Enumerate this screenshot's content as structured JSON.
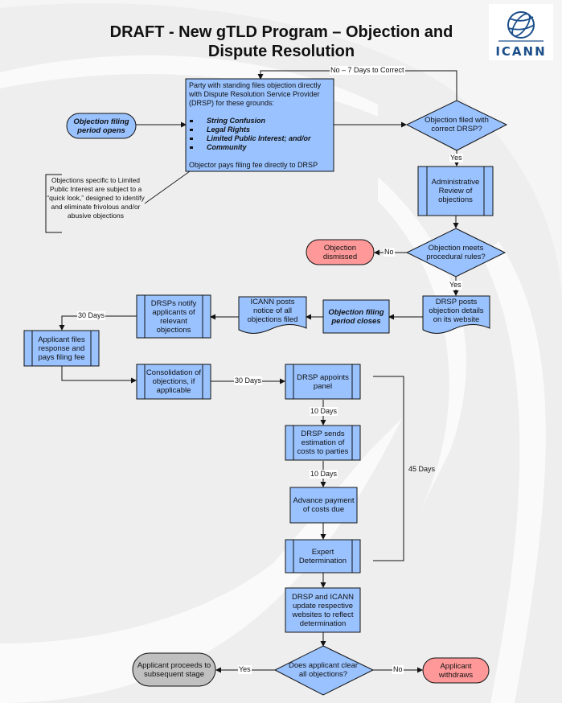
{
  "header": {
    "title_line1": "DRAFT - New gTLD Program – Objection and",
    "title_line2": "Dispute Resolution",
    "logo_text": "ICANN",
    "logo_icon": "globe-icon"
  },
  "colors": {
    "process_fill": "#99c2ff",
    "negative_fill": "#ff9999",
    "neutral_fill": "#c0c0c0",
    "background": "#eeeeee",
    "stroke": "#111111"
  },
  "nodes": {
    "filing_opens": {
      "text_line1": "Objection filing",
      "text_line2": "period opens",
      "shape": "terminator"
    },
    "main_filing": {
      "intro": "Party with standing files objection directly with Dispute Resolution Service Provider (DRSP) for these grounds:",
      "grounds": [
        "String Confusion",
        "Legal Rights",
        "Limited Public Interest; and/or",
        "Community"
      ],
      "footer": "Objector pays filing fee directly to DRSP",
      "shape": "process"
    },
    "quick_look_note": {
      "text": "Objections specific to Limited Public Interest are subject to a “quick look,” designed to identify and eliminate frivolous and/or abusive objections",
      "shape": "annotation"
    },
    "correct_drsp": {
      "text_line1": "Objection filed with",
      "text_line2": "correct DRSP?",
      "shape": "decision"
    },
    "admin_review": {
      "text": "Administrative Review of objections",
      "shape": "predefined-process"
    },
    "procedural_rules": {
      "text_line1": "Objection meets",
      "text_line2": "procedural rules?",
      "shape": "decision"
    },
    "dismissed": {
      "text": "Objection dismissed",
      "shape": "terminator"
    },
    "drsp_posts": {
      "text": "DRSP posts objection details on its website",
      "shape": "document"
    },
    "filing_closes": {
      "text_line1": "Objection filing",
      "text_line2": "period closes",
      "shape": "process"
    },
    "icann_posts": {
      "text": "ICANN posts notice of all objections filed",
      "shape": "document"
    },
    "drsps_notify": {
      "text": "DRSPs notify applicants of relevant objections",
      "shape": "predefined-process"
    },
    "applicant_files": {
      "text": "Applicant files response and pays filing fee",
      "shape": "predefined-process"
    },
    "consolidation": {
      "text": "Consolidation of objections, if applicable",
      "shape": "predefined-process"
    },
    "appoints_panel": {
      "text": "DRSP appoints panel",
      "shape": "predefined-process"
    },
    "sends_estimation": {
      "text": "DRSP sends estimation of costs to parties",
      "shape": "predefined-process"
    },
    "advance_payment": {
      "text": "Advance payment of costs due",
      "shape": "process"
    },
    "expert_determination": {
      "text": "Expert Determination",
      "shape": "predefined-process"
    },
    "update_websites": {
      "text": "DRSP and ICANN update respective websites to reflect determination",
      "shape": "process"
    },
    "clear_objections": {
      "text_line1": "Does applicant clear",
      "text_line2": "all objections?",
      "shape": "decision"
    },
    "proceeds": {
      "text": "Applicant proceeds to subsequent stage",
      "shape": "terminator"
    },
    "withdraws": {
      "text": "Applicant withdraws",
      "shape": "terminator"
    }
  },
  "edge_labels": {
    "no_7_days": "No – 7 Days to Correct",
    "yes_correct": "Yes",
    "no_procedural": "No",
    "yes_procedural": "Yes",
    "days_30_notify": "30 Days",
    "days_30_consolidation": "30 Days",
    "days_10_estimation": "10 Days",
    "days_10_payment": "10 Days",
    "days_45": "45 Days",
    "yes_clear": "Yes",
    "no_clear": "No"
  }
}
